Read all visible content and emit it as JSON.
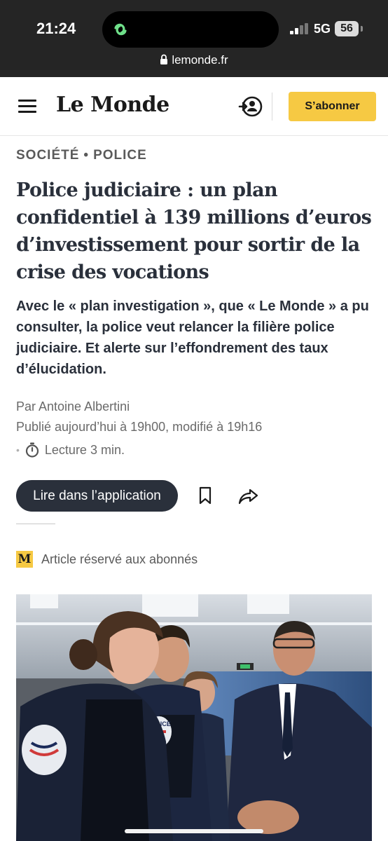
{
  "status_bar": {
    "time": "21:24",
    "network": "5G",
    "battery": "56",
    "url": "lemonde.fr",
    "icons": [
      "activity-icon",
      "signal-icon",
      "lock-icon"
    ]
  },
  "header": {
    "logo": "Le Monde",
    "subscribe_label": "S’abonner",
    "icons": [
      "menu-icon",
      "account-icon"
    ]
  },
  "article": {
    "kicker": {
      "section": "SOCIÉTÉ",
      "separator": "•",
      "subsection": "POLICE"
    },
    "headline": "Police judiciaire : un plan confidentiel à 139 millions d’euros d’investissement pour sortir de la crise des vocations",
    "lede": "Avec le « plan investigation », que « Le Monde » a pu consulter, la police veut relancer la filière police judiciaire. Et alerte sur l’effondrement des taux d’élucidation.",
    "author": "Par Antoine Albertini",
    "published": "Publié aujourd’hui à 19h00, modifié à 19h16",
    "read_time": "Lecture 3 min.",
    "app_button_label": "Lire dans l’application",
    "reserved_badge": "M",
    "reserved_label": "Article réservé aux abonnés",
    "action_icons": [
      "bookmark-icon",
      "share-icon",
      "stopwatch-icon"
    ],
    "photo_patch_text": "POLICE"
  },
  "colors": {
    "status_bar_bg": "#252525",
    "accent_yellow": "#f6c943",
    "headline_text": "#2a303b",
    "button_dark": "#2a303b",
    "meta_gray": "#6a6a6a"
  }
}
